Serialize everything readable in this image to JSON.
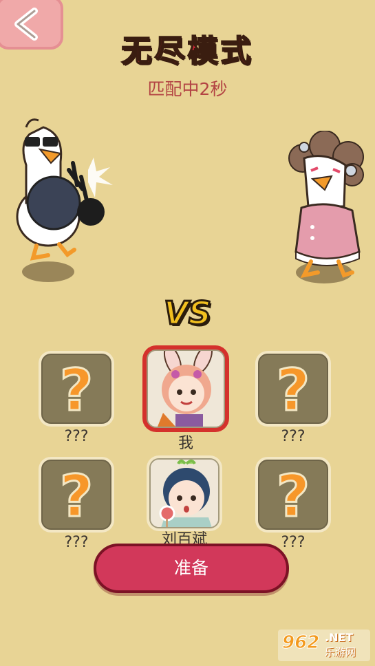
{
  "header": {
    "title": "无尽模式",
    "status": "匹配中2秒"
  },
  "vs_label": "VS",
  "players": [
    {
      "name": "???",
      "avatar": "question-mark"
    },
    {
      "name": "我",
      "avatar": "bunny-girl"
    },
    {
      "name": "???",
      "avatar": "question-mark"
    },
    {
      "name": "???",
      "avatar": "question-mark"
    },
    {
      "name": "刘百斌",
      "avatar": "boy-with-lollipop"
    },
    {
      "name": "???",
      "avatar": "question-mark"
    }
  ],
  "question_glyph": "?",
  "ready_button": "准备",
  "watermark": {
    "logo": "962",
    "net": ".NET",
    "cn": "乐游网"
  },
  "colors": {
    "background": "#e8d495",
    "title": "#d3263a",
    "ready_button": "#d2385a",
    "question_mark": "#f7972a",
    "me_frame": "#d4312c"
  }
}
